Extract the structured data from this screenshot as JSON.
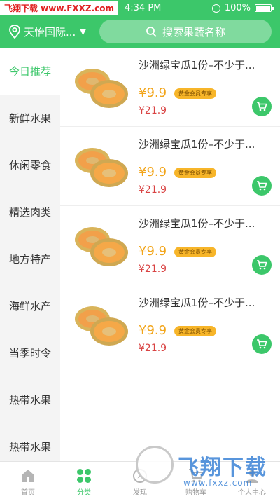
{
  "statusbar": {
    "watermark": "飞翔下载 www.FXXZ.com",
    "time": "4:34 PM",
    "battery": "100%"
  },
  "header": {
    "location": "天怡国际...",
    "search_placeholder": "搜索果蔬名称"
  },
  "sidebar": {
    "items": [
      {
        "label": "今日推荐",
        "active": true
      },
      {
        "label": "新鲜水果",
        "active": false
      },
      {
        "label": "休闲零食",
        "active": false
      },
      {
        "label": "精选肉类",
        "active": false
      },
      {
        "label": "地方特产",
        "active": false
      },
      {
        "label": "海鲜水产",
        "active": false
      },
      {
        "label": "当季时令",
        "active": false
      },
      {
        "label": "热带水果",
        "active": false
      },
      {
        "label": "热带水果",
        "active": false
      }
    ]
  },
  "products": [
    {
      "title": "沙洲绿宝瓜1份–不少于...",
      "price": "¥9.9",
      "badge": "黄金会员专享",
      "orig_price": "¥21.9"
    },
    {
      "title": "沙洲绿宝瓜1份–不少于...",
      "price": "¥9.9",
      "badge": "黄金会员专享",
      "orig_price": "¥21.9"
    },
    {
      "title": "沙洲绿宝瓜1份–不少于...",
      "price": "¥9.9",
      "badge": "黄金会员专享",
      "orig_price": "¥21.9"
    },
    {
      "title": "沙洲绿宝瓜1份–不少于...",
      "price": "¥9.9",
      "badge": "黄金会员专享",
      "orig_price": "¥21.9"
    }
  ],
  "tabbar": {
    "tabs": [
      {
        "label": "首页",
        "icon": "home-icon"
      },
      {
        "label": "分类",
        "icon": "category-icon"
      },
      {
        "label": "发现",
        "icon": "discover-icon"
      },
      {
        "label": "购物车",
        "icon": "cart-icon"
      },
      {
        "label": "个人中心",
        "icon": "user-icon"
      }
    ]
  },
  "watermark_logo": {
    "brand": "飞翔下载",
    "domain": "www.fxxz.com"
  },
  "colors": {
    "accent": "#3cc76a",
    "price": "#f2a51a",
    "orig_price": "#d94343"
  }
}
